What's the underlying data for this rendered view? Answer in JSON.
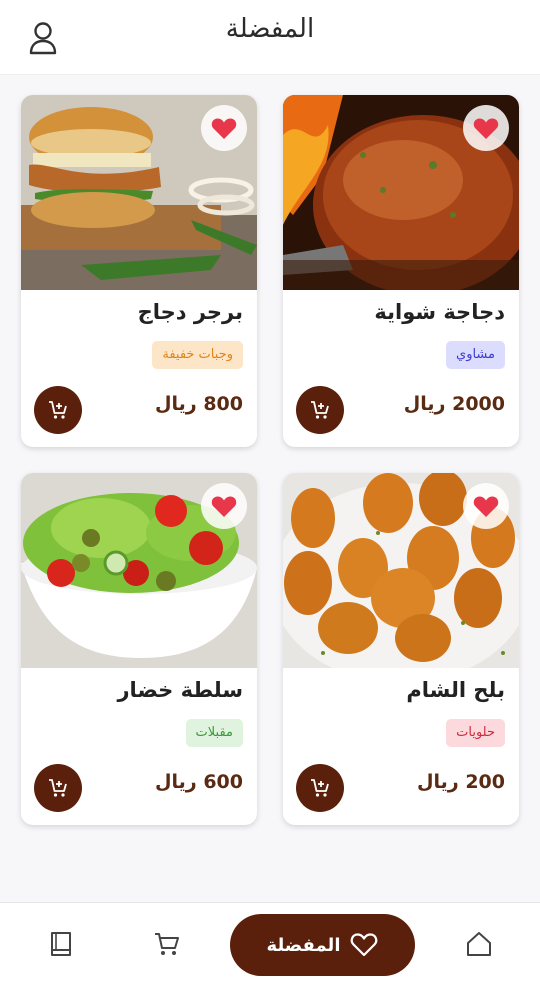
{
  "header": {
    "title": "المفضلة"
  },
  "items": [
    {
      "name": "دجاجة شواية",
      "tag": "مشاوي",
      "price": "2000 ريال",
      "tag_bg": "#dcdcff",
      "tag_color": "#3b3bd0"
    },
    {
      "name": "برجر دجاج",
      "tag": "وجبات خفيفة",
      "price": "800 ريال",
      "tag_bg": "#fde6c8",
      "tag_color": "#e08418"
    },
    {
      "name": "بلح الشام",
      "tag": "حلويات",
      "price": "200 ريال",
      "tag_bg": "#fbd9dd",
      "tag_color": "#d12b3d"
    },
    {
      "name": "سلطة خضار",
      "tag": "مقبلات",
      "price": "600 ريال",
      "tag_bg": "#dff3df",
      "tag_color": "#3a9a3a"
    }
  ],
  "bottom_nav": {
    "active_label": "المفضلة"
  },
  "colors": {
    "brand": "#5b200c",
    "favorite": "#e8374b"
  }
}
